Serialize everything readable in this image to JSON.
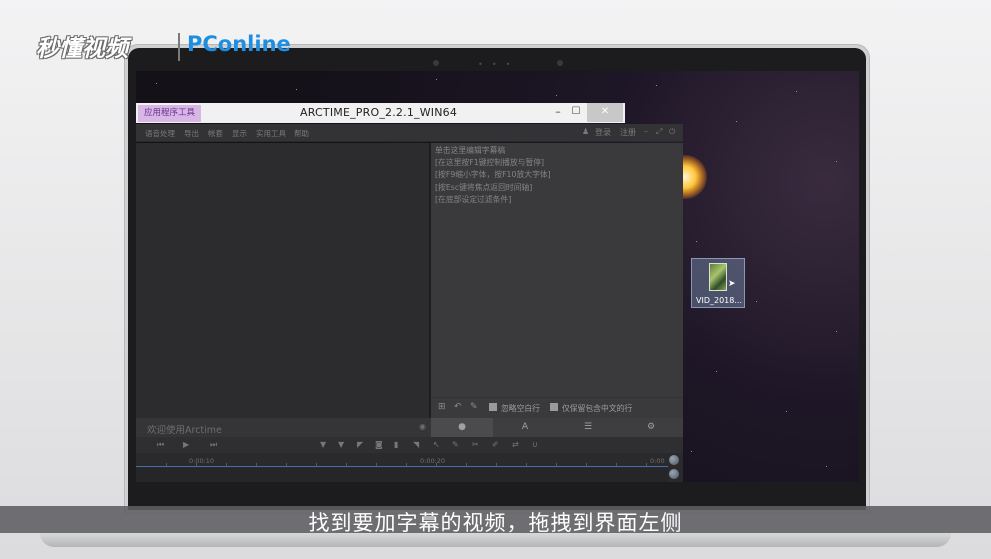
{
  "watermark": {
    "brand_cn": "秒懂视频",
    "brand_pc": "PConline"
  },
  "window": {
    "app_tag": "应用程序工具",
    "title": "ARCTIME_PRO_2.2.1_WIN64",
    "min": "–",
    "max": "☐",
    "close": "✕"
  },
  "menu": {
    "items": [
      "语音处理",
      "导出",
      "帐套",
      "显示",
      "实用工具",
      "帮助"
    ],
    "right": {
      "user_icon": "person-icon",
      "login": "登录",
      "register": "注册"
    }
  },
  "subtitle_panel": {
    "hints": [
      "单击这里编辑字幕稿",
      "[在这里按F1键控制播放与暂停]",
      "[按F9缩小字体，按F10放大字体]",
      "[按Esc键将焦点返回时间轴]",
      "[在底部设定过滤条件]"
    ],
    "filter1": "忽略空白行",
    "filter2": "仅保留包含中文的行"
  },
  "welcome": "欢迎使用Arctime",
  "tabs": [
    {
      "icon": "chat-icon",
      "glyph": "●"
    },
    {
      "icon": "font-icon",
      "glyph": "A"
    },
    {
      "icon": "list-icon",
      "glyph": "☰"
    },
    {
      "icon": "gear-icon",
      "glyph": "⚙"
    }
  ],
  "timeline": {
    "t0": "0:00:10",
    "t1": "0:00:20",
    "t2": "0:00"
  },
  "desktop_icon": {
    "label": "VID_2018..."
  },
  "caption": "找到要加字幕的视频，拖拽到界面左侧"
}
